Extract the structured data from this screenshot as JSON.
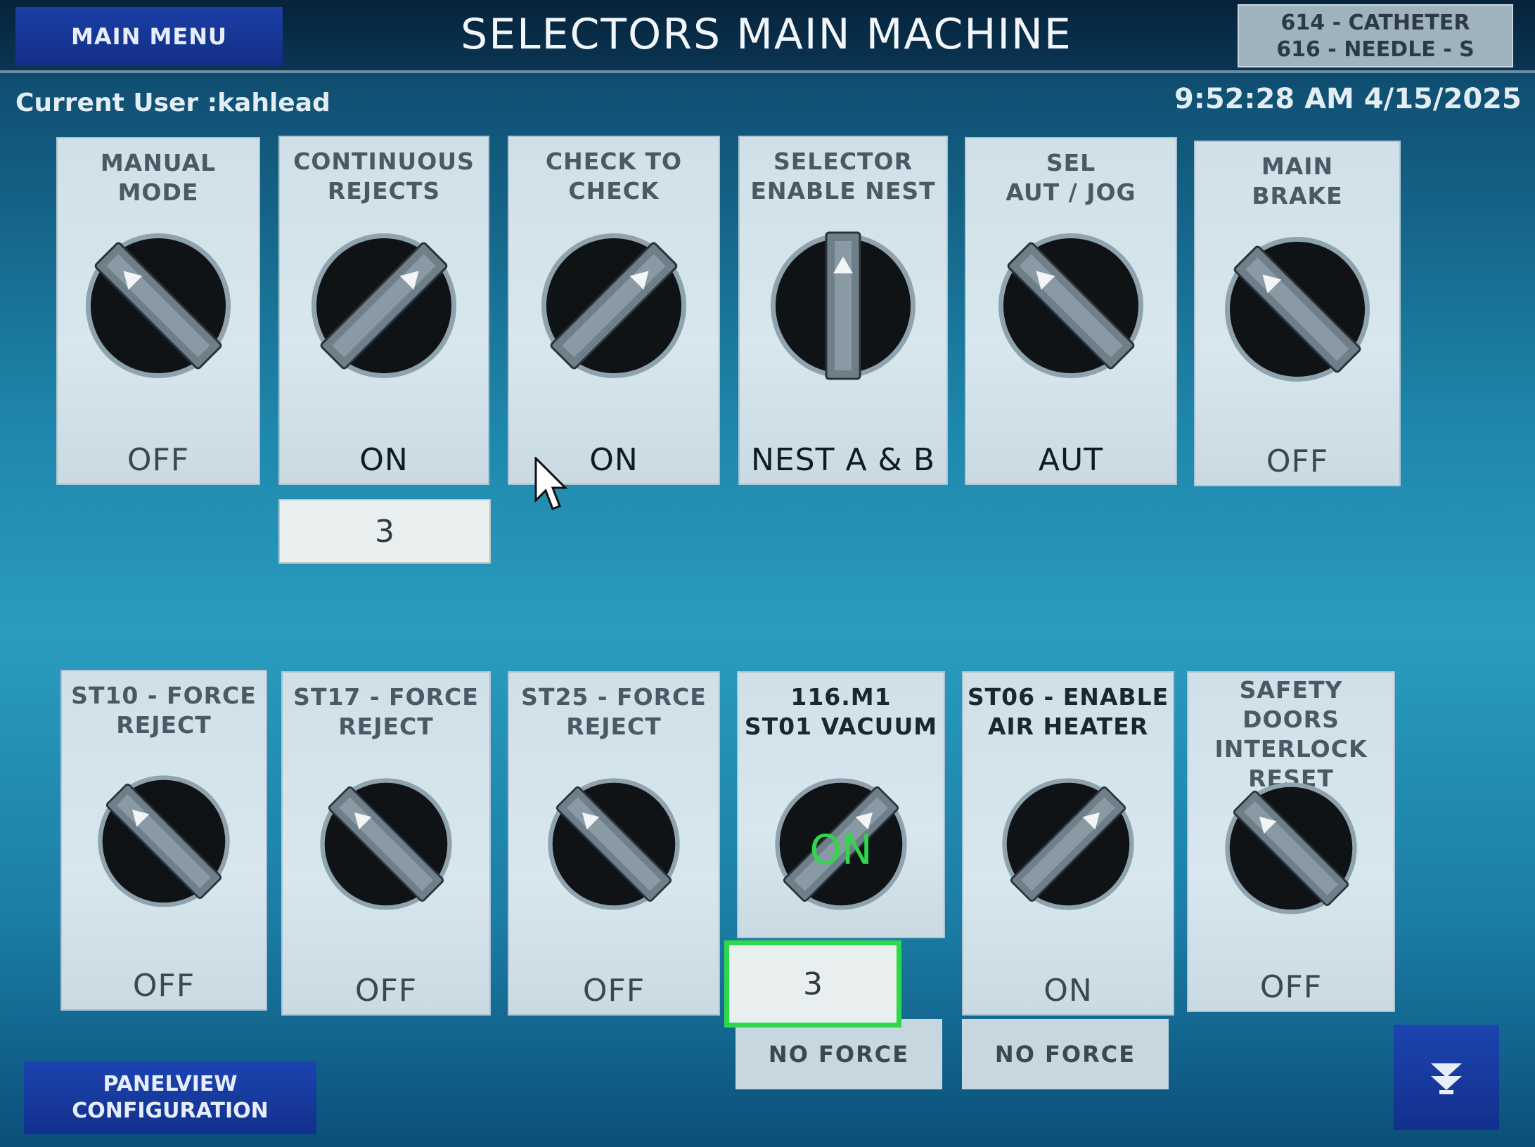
{
  "header": {
    "main_menu": "MAIN MENU",
    "title": "SELECTORS MAIN MACHINE",
    "recipe_line1": "614 - CATHETER",
    "recipe_line2": "616 - NEEDLE - S"
  },
  "status": {
    "user": "Current User :kahlead",
    "datetime": "9:52:28 AM 4/15/2025"
  },
  "selectors_top": [
    {
      "title": "MANUAL\nMODE",
      "state": "OFF"
    },
    {
      "title": "CONTINUOUS\nREJECTS",
      "state": "ON",
      "value": "3"
    },
    {
      "title": "CHECK TO\nCHECK",
      "state": "ON"
    },
    {
      "title": "SELECTOR\nENABLE NEST",
      "state": "NEST A & B"
    },
    {
      "title": "SEL\nAUT / JOG",
      "state": "AUT"
    },
    {
      "title": "MAIN\nBRAKE",
      "state": "OFF"
    }
  ],
  "selectors_bottom": [
    {
      "title": "ST10 - FORCE\nREJECT",
      "state": "OFF"
    },
    {
      "title": "ST17 - FORCE\nREJECT",
      "state": "OFF"
    },
    {
      "title": "ST25 - FORCE\nREJECT",
      "state": "OFF"
    },
    {
      "title": "116.M1\nST01 VACUUM",
      "overlay": "ON",
      "value": "3",
      "force": "NO FORCE"
    },
    {
      "title": "ST06 - ENABLE\nAIR HEATER",
      "state": "ON",
      "force": "NO FORCE"
    },
    {
      "title": "SAFETY DOORS\nINTERLOCK\nRESET",
      "state": "OFF"
    }
  ],
  "footer": {
    "panelview_line1": "PANELVIEW",
    "panelview_line2": "CONFIGURATION"
  },
  "icons": {
    "nav": "next-page-icon",
    "selector": "rotary-selector-icon"
  },
  "colors": {
    "accent_button": "#1c44b0",
    "panel": "#d3e3ea",
    "on_overlay": "#2fd84a",
    "focus_border": "#2fd84a"
  }
}
